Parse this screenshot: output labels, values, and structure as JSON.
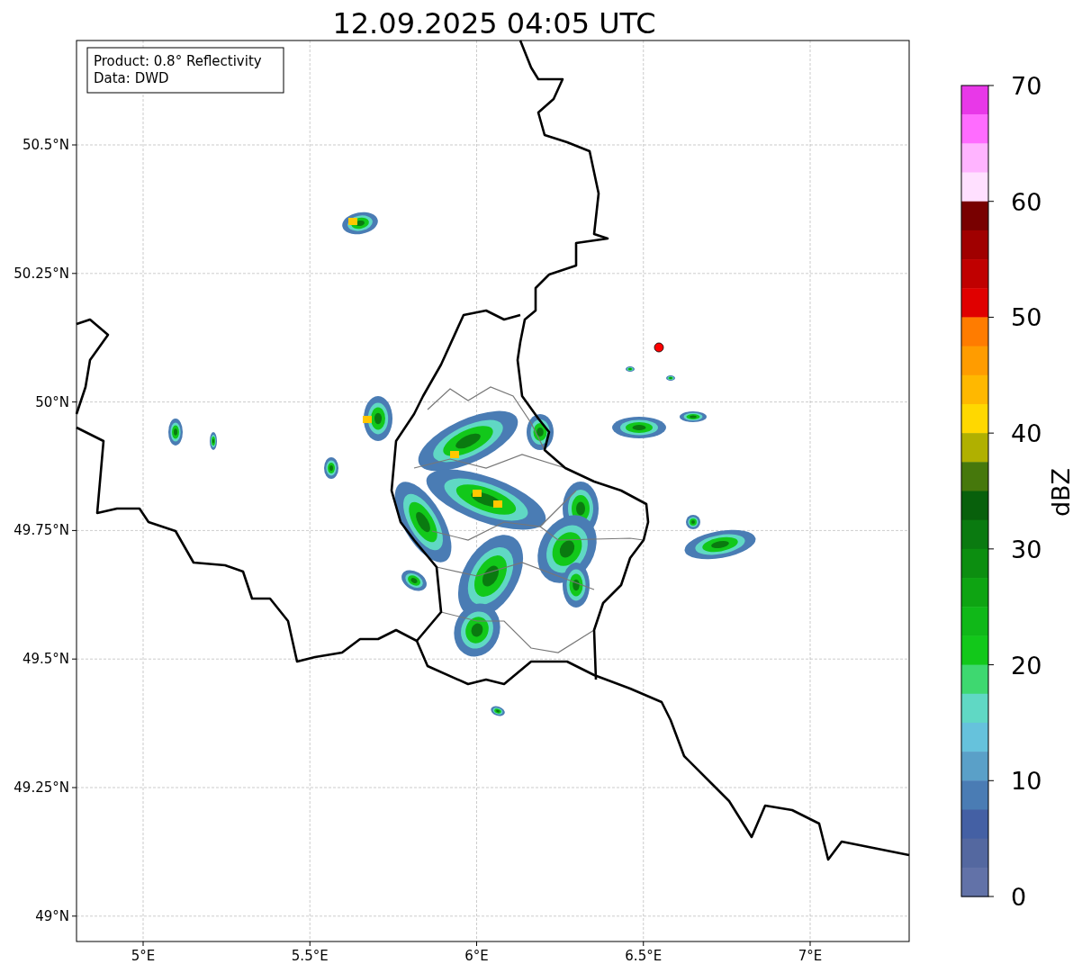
{
  "title": "12.09.2025 04:05 UTC",
  "info_box": {
    "lines": [
      "Product: 0.8° Reflectivity",
      "Data: DWD"
    ]
  },
  "map": {
    "xticks": [
      "5°E",
      "5.5°E",
      "6°E",
      "6.5°E",
      "7°E"
    ],
    "yticks": [
      "50.5°N",
      "50.25°N",
      "50°N",
      "49.75°N",
      "49.5°N",
      "49.25°N",
      "49°N"
    ]
  },
  "colorbar": {
    "label": "dBZ",
    "ticks": [
      "70",
      "60",
      "50",
      "40",
      "30",
      "20",
      "10",
      "0"
    ],
    "segments": [
      {
        "color": "#e838e8"
      },
      {
        "color": "#ff6cff"
      },
      {
        "color": "#ffb4ff"
      },
      {
        "color": "#ffe0ff"
      },
      {
        "color": "#780000"
      },
      {
        "color": "#a00000"
      },
      {
        "color": "#c00000"
      },
      {
        "color": "#e00000"
      },
      {
        "color": "#ff7c00"
      },
      {
        "color": "#ff9c00"
      },
      {
        "color": "#ffb800"
      },
      {
        "color": "#ffd800"
      },
      {
        "color": "#b0b000"
      },
      {
        "color": "#46780c"
      },
      {
        "color": "#08600c"
      },
      {
        "color": "#0a7a10"
      },
      {
        "color": "#0c8e10"
      },
      {
        "color": "#0ea412"
      },
      {
        "color": "#10b818"
      },
      {
        "color": "#12c81a"
      },
      {
        "color": "#3ed870"
      },
      {
        "color": "#60d8c4"
      },
      {
        "color": "#66c2dc"
      },
      {
        "color": "#5aa0c8"
      },
      {
        "color": "#4a7cb4"
      },
      {
        "color": "#4460a4"
      },
      {
        "color": "#5468a0"
      },
      {
        "color": "#6272a8"
      }
    ]
  }
}
